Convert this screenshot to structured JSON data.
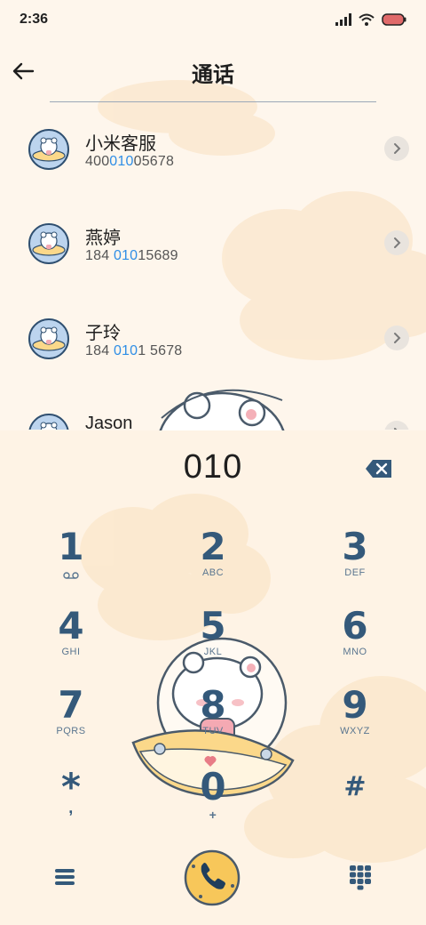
{
  "status": {
    "time": "2:36"
  },
  "header": {
    "title": "通话"
  },
  "contacts": [
    {
      "name": "小米客服",
      "num_pre": "400",
      "num_hl": "010",
      "num_post": "05678"
    },
    {
      "name": "燕婷",
      "num_pre": "184 ",
      "num_hl": "010",
      "num_post": "15689"
    },
    {
      "name": "子玲",
      "num_pre": "184 ",
      "num_hl": "010",
      "num_post": "1 5678"
    },
    {
      "name": "Jason",
      "num_pre": "",
      "num_hl": "",
      "num_post": ""
    }
  ],
  "dialer": {
    "input": "010",
    "keys": [
      {
        "digit": "1",
        "letters": "voicemail"
      },
      {
        "digit": "2",
        "letters": "ABC"
      },
      {
        "digit": "3",
        "letters": "DEF"
      },
      {
        "digit": "4",
        "letters": "GHI"
      },
      {
        "digit": "5",
        "letters": "JKL"
      },
      {
        "digit": "6",
        "letters": "MNO"
      },
      {
        "digit": "7",
        "letters": "PQRS"
      },
      {
        "digit": "8",
        "letters": "TUV"
      },
      {
        "digit": "9",
        "letters": "WXYZ"
      },
      {
        "digit": "*",
        "letters": ","
      },
      {
        "digit": "0",
        "letters": "+"
      },
      {
        "digit": "#",
        "letters": ""
      }
    ]
  },
  "colors": {
    "accent": "#2f8ee6",
    "key": "#34597a",
    "bg": "#fef6ec",
    "call": "#f7c75a"
  },
  "icons": [
    "back-arrow-icon",
    "signal-icon",
    "wifi-icon",
    "battery-icon",
    "chevron-right-icon",
    "backspace-icon",
    "menu-icon",
    "phone-icon",
    "keypad-icon"
  ]
}
